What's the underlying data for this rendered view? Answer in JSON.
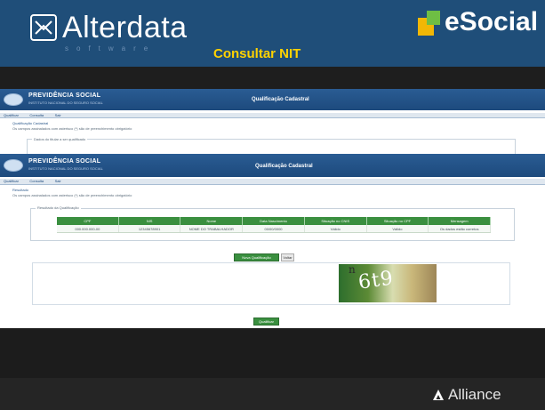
{
  "banner": {
    "brand": "Alterdata",
    "brand_sub": "software",
    "partner_brand": "eSocial",
    "title": "Consultar NIT",
    "brand_color": "#1f4e79",
    "title_color": "#ffd200"
  },
  "back_screen": {
    "brand": "PREVIDÊNCIA SOCIAL",
    "brand_sub": "INSTITUTO NACIONAL DO SEGURO SOCIAL",
    "title": "Qualificação Cadastral",
    "menu": [
      "Qualificar",
      "Consulta",
      "Sair"
    ],
    "heading": "Qualificação Cadastral",
    "subtitle": "Os campos assinalados com asterisco (*) são de preenchimento obrigatório",
    "fieldset_label": "Dados do titular a ser qualificado"
  },
  "front_screen": {
    "brand": "PREVIDÊNCIA SOCIAL",
    "brand_sub": "INSTITUTO NACIONAL DO SEGURO SOCIAL",
    "title": "Qualificação Cadastral",
    "menu": [
      "Qualificar",
      "Consulta",
      "Sair"
    ],
    "heading": "Resultado",
    "subtitle": "Os campos assinalados com asterisco (*) são de preenchimento obrigatório",
    "fieldset_label": "Resultado da Qualificação",
    "columns": [
      "CPF",
      "NIS",
      "Nome",
      "Data Nascimento",
      "Situação no CNIS",
      "Situação no CPF",
      "Mensagem"
    ],
    "row": [
      "000.000.000-00",
      "12345678901",
      "NOME DO TRABALHADOR",
      "00/00/0000",
      "Válido",
      "Válido",
      "Os dados estão corretos"
    ],
    "btn_new_label": "Nova Qualificação",
    "btn_back_label": "Voltar",
    "captcha_text": "6t9",
    "captcha_hint": "n",
    "btn_submit_label": "Qualificar",
    "accent_color": "#3a8f3f"
  },
  "footer": {
    "brand": "Alliance"
  }
}
